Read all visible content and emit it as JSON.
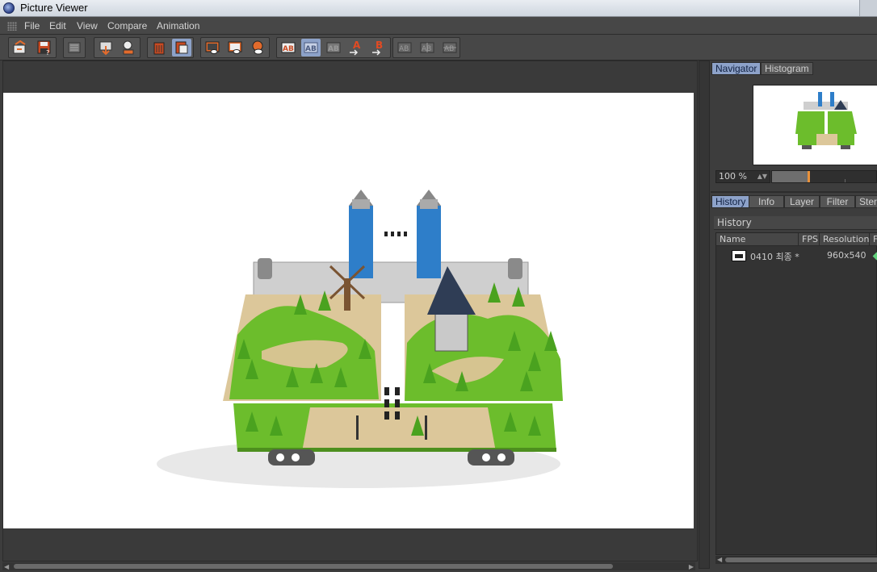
{
  "window": {
    "title": "Picture Viewer"
  },
  "menu": [
    "File",
    "Edit",
    "View",
    "Compare",
    "Animation"
  ],
  "toolbar": {
    "icons": [
      "open-file-icon",
      "save-icon",
      "save-sequence-icon",
      "adjust-size-icon",
      "export-icon",
      "delete-icon",
      "clear-all-icon",
      "show-region-icon",
      "show-region-2-icon",
      "show-alpha-icon",
      "ab-compare-icon",
      "ab-side-icon",
      "ab-split-icon",
      "set-a-icon",
      "set-b-icon",
      "swap-ab-icon",
      "overlay-ab-icon",
      "difference-ab-icon"
    ],
    "label_a": "A",
    "label_b": "B"
  },
  "navigator": {
    "tabs": [
      "Navigator",
      "Histogram"
    ],
    "zoom_value": "100 %",
    "zoom_slider_fraction": 0.35
  },
  "history": {
    "tabs": [
      "History",
      "Info",
      "Layer",
      "Filter",
      "Stere"
    ],
    "section_title": "History",
    "columns": [
      "Name",
      "FPS",
      "Resolution",
      "F"
    ],
    "rows": [
      {
        "name": "0410 최종 *",
        "fps": "",
        "resolution": "960x540"
      }
    ]
  },
  "colors": {
    "accent_tab": "#8da2c9",
    "slider_handle": "#e9913b",
    "status_dot": "#5fd07a"
  }
}
